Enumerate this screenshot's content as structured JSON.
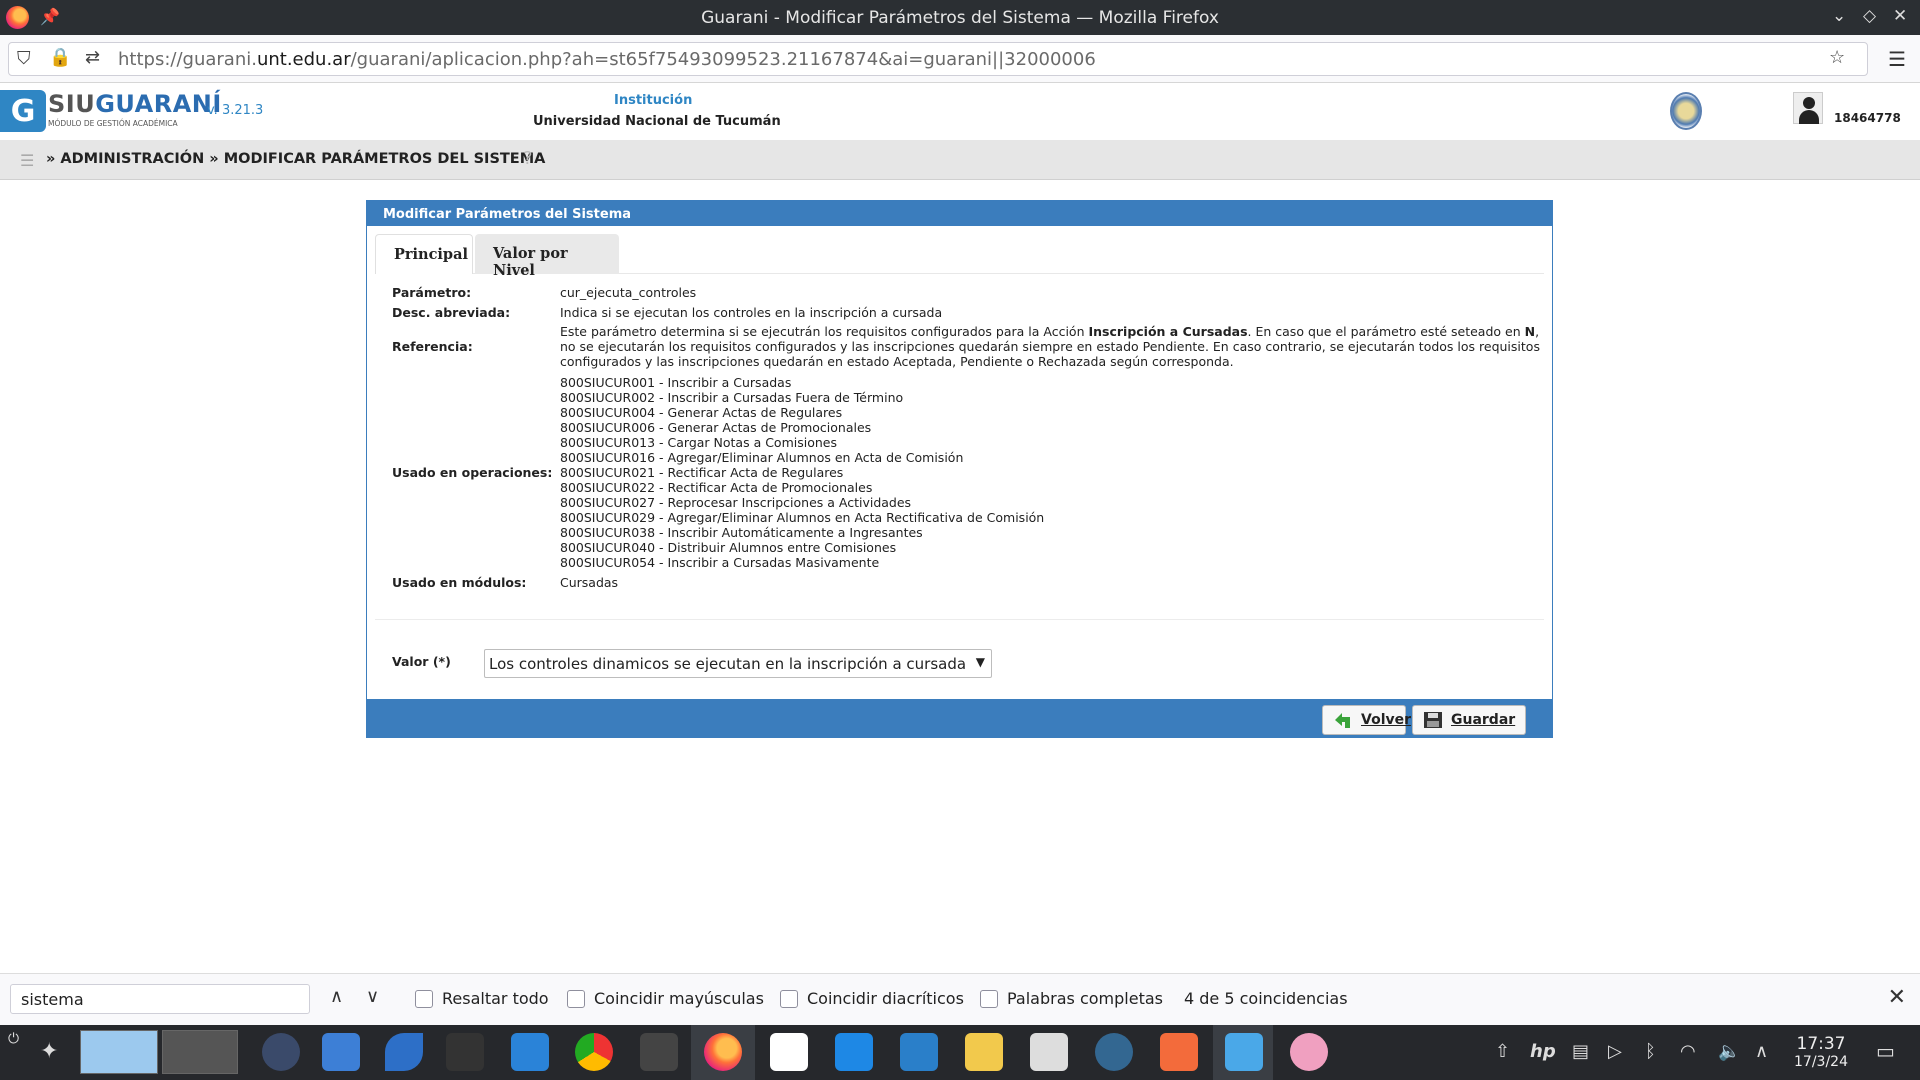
{
  "window": {
    "title": "Guarani - Modificar Parámetros del Sistema — Mozilla Firefox"
  },
  "browser": {
    "url_prefix": "https://guarani.",
    "url_domain": "unt.edu.ar",
    "url_path": "/guarani/aplicacion.php?ah=st65f75493099523.21167874&ai=guarani||32000006"
  },
  "header": {
    "logo_siu": "SIU",
    "logo_guarani": "GUARANÍ",
    "logo_subtitle": "MÓDULO DE GESTIÓN ACADÉMICA",
    "version": "v. 3.21.3",
    "institution_label": "Institución",
    "institution_name": "Universidad Nacional de Tucumán",
    "user_id": "18464778"
  },
  "breadcrumb": {
    "text": "» ADMINISTRACIÓN » MODIFICAR PARÁMETROS DEL SISTEMA"
  },
  "panel": {
    "title": "Modificar Parámetros del Sistema",
    "tabs": [
      "Principal",
      "Valor por Nivel"
    ],
    "labels": {
      "parametro": "Parámetro:",
      "desc": "Desc. abreviada:",
      "referencia": "Referencia:",
      "operaciones": "Usado en operaciones:",
      "modulos": "Usado en módulos:",
      "valor": "Valor (*)"
    },
    "parametro": "cur_ejecuta_controles",
    "desc": "Indica si se ejecutan los controles en la inscripción a cursada",
    "referencia_1": "Este parámetro determina si se ejecutrán los requisitos configurados para la Acción ",
    "referencia_bold1": "Inscripción a Cursadas",
    "referencia_2": ". En caso que el parámetro esté seteado en ",
    "referencia_bold2": "N",
    "referencia_3": ", no se ejecutarán los requisitos configurados y las inscripciones quedarán siempre en estado Pendiente. En caso contrario, se ejecutarán todos los requisitos configurados y las inscripciones quedarán en estado Aceptada, Pendiente o Rechazada según corresponda.",
    "operaciones": [
      "800SIUCUR001 - Inscribir a Cursadas",
      "800SIUCUR002 - Inscribir a Cursadas Fuera de Término",
      "800SIUCUR004 - Generar Actas de Regulares",
      "800SIUCUR006 - Generar Actas de Promocionales",
      "800SIUCUR013 - Cargar Notas a Comisiones",
      "800SIUCUR016 - Agregar/Eliminar Alumnos en Acta de Comisión",
      "800SIUCUR021 - Rectificar Acta de Regulares",
      "800SIUCUR022 - Rectificar Acta de Promocionales",
      "800SIUCUR027 - Reprocesar Inscripciones a Actividades",
      "800SIUCUR029 - Agregar/Eliminar Alumnos en Acta Rectificativa de Comisión",
      "800SIUCUR038 - Inscribir Automáticamente a Ingresantes",
      "800SIUCUR040 - Distribuir Alumnos entre Comisiones",
      "800SIUCUR054 - Inscribir a Cursadas Masivamente"
    ],
    "modulos": "Cursadas",
    "valor_selected": "Los controles dinamicos se ejecutan en la inscripción a cursada",
    "btn_volver": "Volver",
    "btn_guardar": "Guardar"
  },
  "findbar": {
    "query": "sistema",
    "opt_highlight": "Resaltar todo",
    "opt_case": "Coincidir mayúsculas",
    "opt_diacritics": "Coincidir diacríticos",
    "opt_whole": "Palabras completas",
    "count": "4 de 5 coincidencias"
  },
  "taskbar": {
    "time": "17:37",
    "date": "17/3/24"
  }
}
